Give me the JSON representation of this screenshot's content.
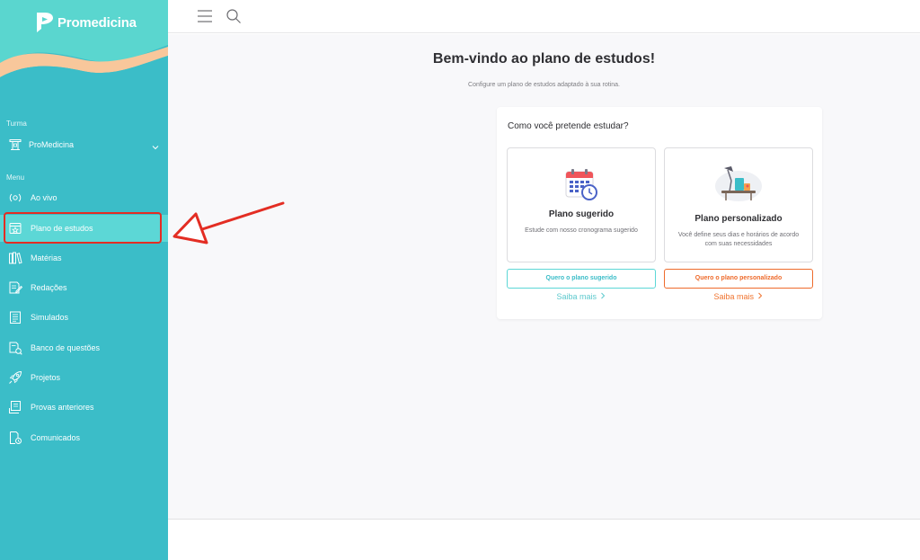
{
  "app": {
    "brand": "Promedicina"
  },
  "sidebar": {
    "turma_label": "Turma",
    "turma_value": "ProMedicina",
    "menu_label": "Menu",
    "items": [
      {
        "label": "Ao vivo",
        "icon": "live-icon",
        "active": false
      },
      {
        "label": "Plano de estudos",
        "icon": "study-plan-icon",
        "active": true
      },
      {
        "label": "Matérias",
        "icon": "books-icon",
        "active": false
      },
      {
        "label": "Redações",
        "icon": "essay-icon",
        "active": false
      },
      {
        "label": "Simulados",
        "icon": "exam-icon",
        "active": false
      },
      {
        "label": "Banco de questões",
        "icon": "question-bank-icon",
        "active": false
      },
      {
        "label": "Projetos",
        "icon": "rocket-icon",
        "active": false
      },
      {
        "label": "Provas anteriores",
        "icon": "past-exams-icon",
        "active": false
      },
      {
        "label": "Comunicados",
        "icon": "announcements-icon",
        "active": false
      }
    ]
  },
  "main": {
    "title": "Bem-vindo ao plano de estudos!",
    "subtitle": "Configure um plano de estudos adaptado à sua rotina.",
    "question": "Como você pretende estudar?",
    "options": [
      {
        "title": "Plano sugerido",
        "description": "Estude com nosso cronograma sugerido",
        "button": "Quero o plano sugerido",
        "link": "Saiba mais"
      },
      {
        "title": "Plano personalizado",
        "description": "Você define seus dias e horários de acordo com suas necessidades",
        "button": "Quero o plano personalizado",
        "link": "Saiba mais"
      }
    ]
  },
  "colors": {
    "sidebar": "#3bbdc8",
    "active_item": "#5cd7d6",
    "highlight": "#e32d23",
    "orange": "#ee6b2c"
  }
}
